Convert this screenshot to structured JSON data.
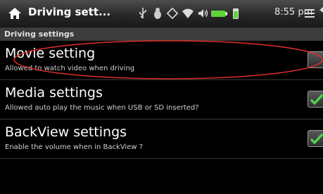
{
  "titlebar": {
    "title": "Driving sett...",
    "clock": "8:55 pm",
    "colors": {
      "bar": "#262626",
      "battery": "#5fd53a"
    }
  },
  "section": {
    "header": "Driving settings"
  },
  "settings": [
    {
      "title": "Movie setting",
      "subtitle": "Allowed to watch video when driving",
      "checked": false,
      "highlighted": true
    },
    {
      "title": "Media settings",
      "subtitle": "Allowed auto play the music when USB or SD inserted?",
      "checked": true
    },
    {
      "title": "BackView settings",
      "subtitle": "Enable the volume when in BackView ?",
      "checked": true
    }
  ],
  "icons": [
    "home-icon",
    "usb-icon",
    "debug-icon",
    "gps-icon",
    "wifi-icon",
    "volume-icon",
    "battery-icon",
    "overflow-menu-icon",
    "back-icon"
  ],
  "accent": {
    "check": "#4fd24a",
    "highlight": "#e0302a"
  }
}
